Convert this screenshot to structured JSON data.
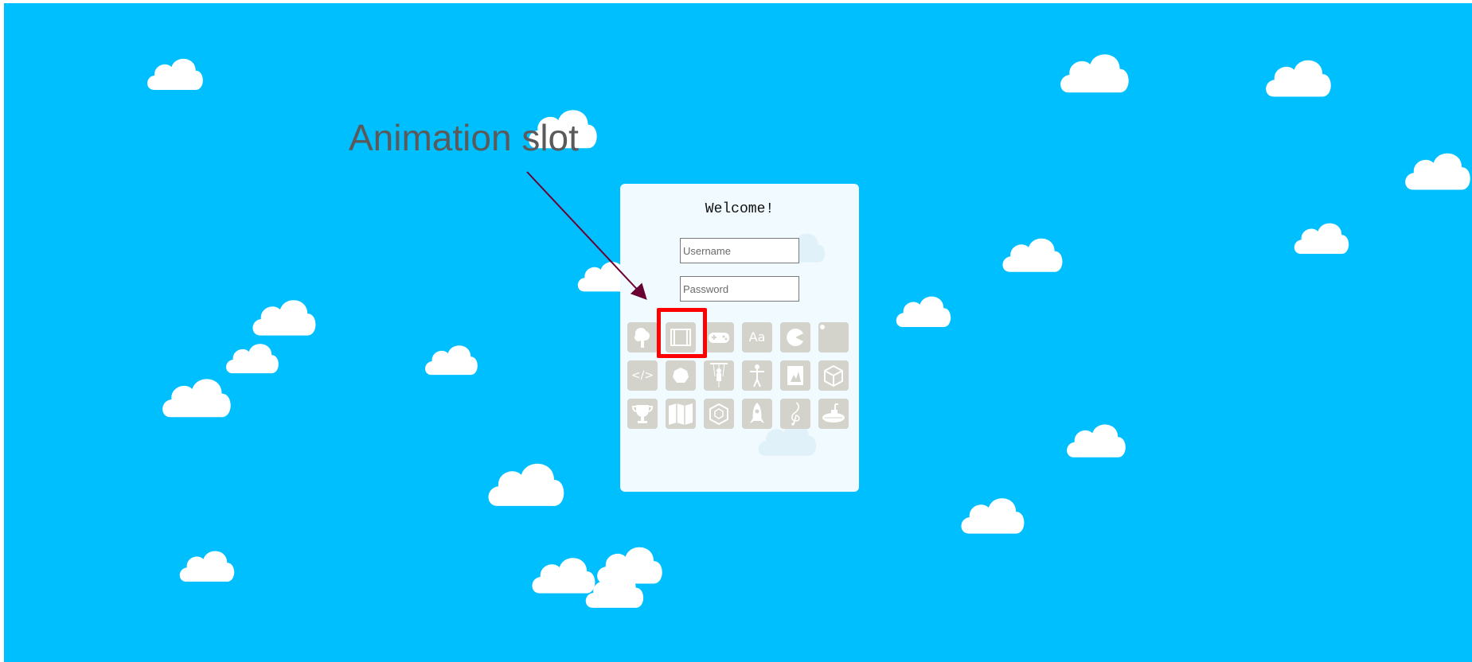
{
  "annotation": {
    "label": "Animation slot",
    "arrow_color": "#6b0032",
    "highlight_color": "#ff0000"
  },
  "theme": {
    "sky_color": "#00bfff",
    "cloud_color": "#ffffff",
    "card_color": "#f0faff",
    "slot_color": "#d3d3cc"
  },
  "login": {
    "title": "Welcome!",
    "username_placeholder": "Username",
    "password_placeholder": "Password"
  },
  "slots": [
    {
      "icon": "tree-icon"
    },
    {
      "icon": "animation-frame-icon"
    },
    {
      "icon": "gamepad-icon"
    },
    {
      "icon": "font-icon",
      "text": "Aa"
    },
    {
      "icon": "pie-icon"
    },
    {
      "icon": "dot-icon"
    },
    {
      "icon": "code-icon",
      "text": "</>"
    },
    {
      "icon": "circle-icon"
    },
    {
      "icon": "puppet-icon"
    },
    {
      "icon": "stick-figure-icon"
    },
    {
      "icon": "picture-icon"
    },
    {
      "icon": "cube-icon"
    },
    {
      "icon": "trophy-icon"
    },
    {
      "icon": "map-icon"
    },
    {
      "icon": "box-icon"
    },
    {
      "icon": "rocket-icon"
    },
    {
      "icon": "music-note-icon"
    },
    {
      "icon": "submarine-icon"
    }
  ]
}
